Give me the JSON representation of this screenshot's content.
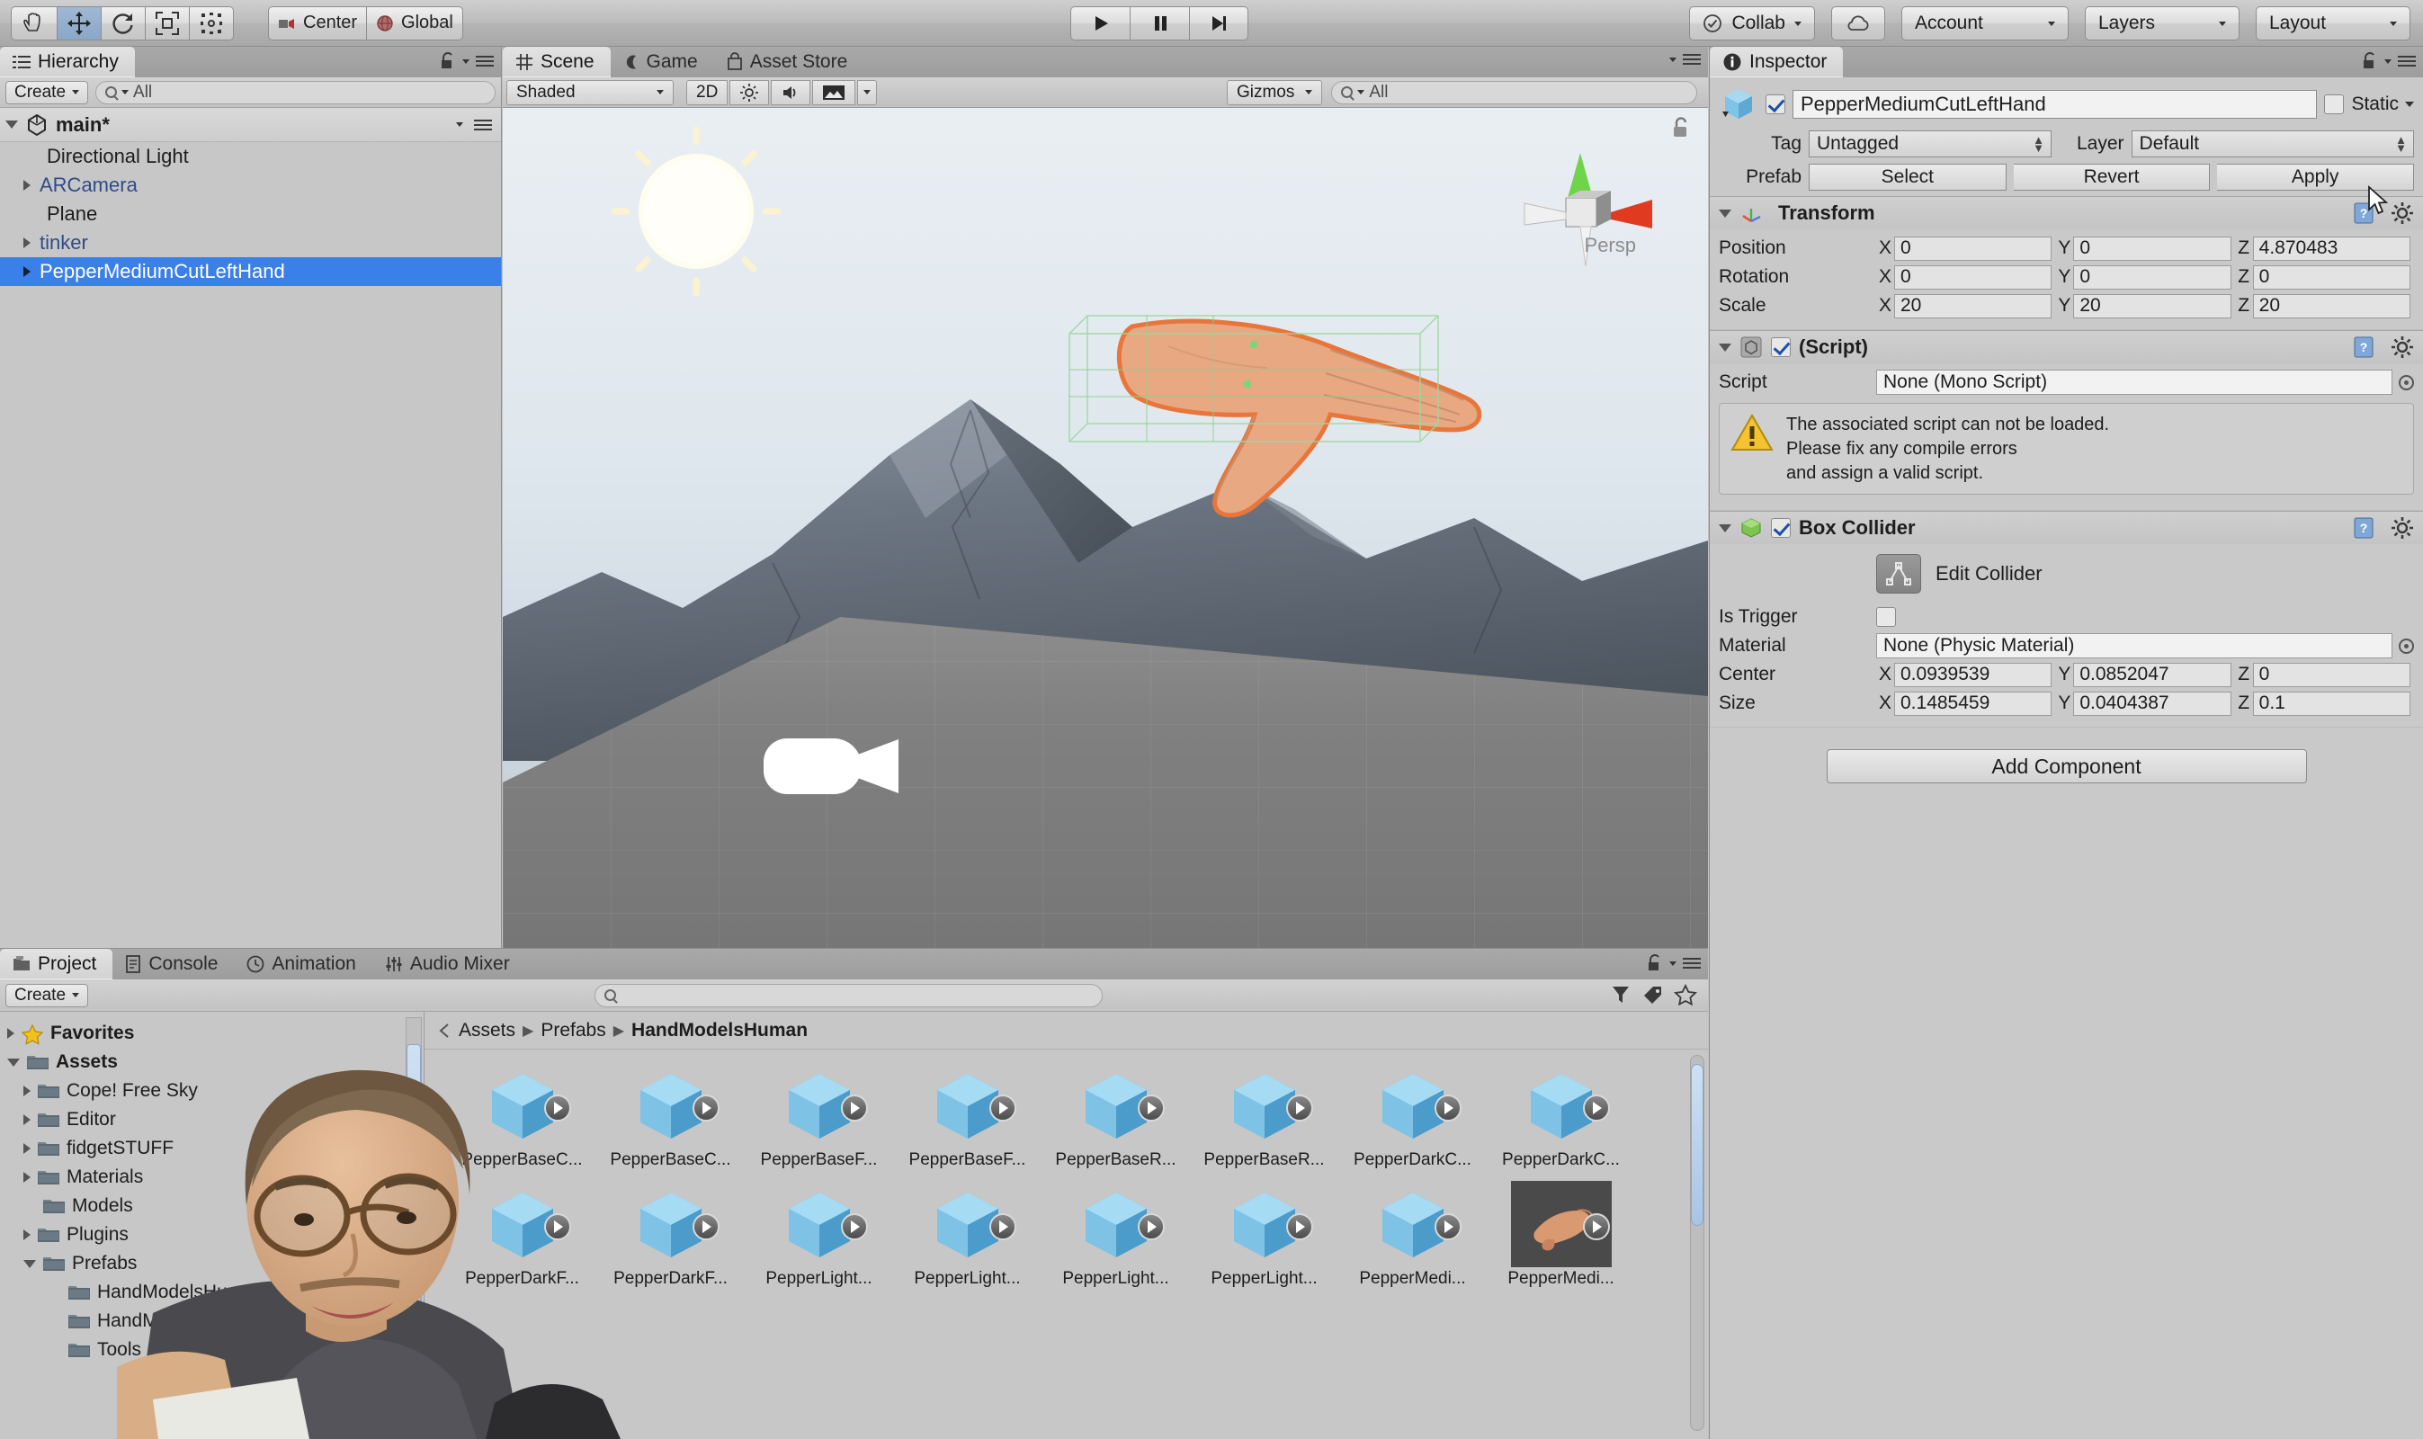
{
  "toolbar": {
    "tools": [
      {
        "name": "hand-tool",
        "icon": "hand"
      },
      {
        "name": "move-tool",
        "icon": "move"
      },
      {
        "name": "rotate-tool",
        "icon": "rotate"
      },
      {
        "name": "scale-tool",
        "icon": "scale"
      },
      {
        "name": "rect-tool",
        "icon": "rect"
      }
    ],
    "pivot_mode": "Center",
    "pivot_rotation": "Global",
    "transport": [
      "play",
      "pause",
      "step"
    ],
    "collab": "Collab",
    "cloud_icon": "cloud-icon",
    "account": "Account",
    "layers": "Layers",
    "layout": "Layout"
  },
  "hierarchy": {
    "tab": "Hierarchy",
    "create_label": "Create",
    "search_placeholder": "All",
    "scene_name": "main*",
    "items": [
      {
        "label": "Directional Light",
        "arrow": false,
        "prefab": false,
        "selected": false
      },
      {
        "label": "ARCamera",
        "arrow": true,
        "prefab": true,
        "selected": false
      },
      {
        "label": "Plane",
        "arrow": false,
        "prefab": false,
        "selected": false
      },
      {
        "label": "tinker",
        "arrow": true,
        "prefab": true,
        "selected": false
      },
      {
        "label": "PepperMediumCutLeftHand",
        "arrow": true,
        "prefab": true,
        "selected": true
      }
    ]
  },
  "scene": {
    "tabs": [
      {
        "label": "Scene",
        "icon": "grid-icon",
        "active": true
      },
      {
        "label": "Game",
        "icon": "gamepad-icon",
        "active": false
      },
      {
        "label": "Asset Store",
        "icon": "store-icon",
        "active": false
      }
    ],
    "draw_mode": "Shaded",
    "two_d": "2D",
    "lighting_icon": "sun-toggle-icon",
    "audio_icon": "audio-toggle-icon",
    "fx_icon": "effects-icon",
    "gizmos": "Gizmos",
    "search_placeholder": "All",
    "projection_label": "Persp"
  },
  "inspector": {
    "tab": "Inspector",
    "object_name": "PepperMediumCutLeftHand",
    "enabled": true,
    "static_label": "Static",
    "static_checked": false,
    "tag_label": "Tag",
    "tag_value": "Untagged",
    "layer_label": "Layer",
    "layer_value": "Default",
    "prefab_label": "Prefab",
    "prefab_buttons": [
      "Select",
      "Revert",
      "Apply"
    ],
    "components": [
      {
        "name": "Transform",
        "icon": "transform-axis-icon",
        "has_checkbox": false,
        "rows": [
          {
            "label": "Position",
            "x": "0",
            "y": "0",
            "z": "4.870483"
          },
          {
            "label": "Rotation",
            "x": "0",
            "y": "0",
            "z": "0"
          },
          {
            "label": "Scale",
            "x": "20",
            "y": "20",
            "z": "20"
          }
        ]
      },
      {
        "name": "(Script)",
        "icon": "script-icon",
        "has_checkbox": true,
        "checked": true,
        "script_label": "Script",
        "script_value": "None (Mono Script)",
        "warning_lines": [
          "The associated script can not be loaded.",
          "Please fix any compile errors",
          "and assign a valid script."
        ]
      },
      {
        "name": "Box Collider",
        "icon": "box-collider-icon",
        "has_checkbox": true,
        "checked": true,
        "edit_collider_label": "Edit Collider",
        "is_trigger_label": "Is Trigger",
        "is_trigger_checked": false,
        "material_label": "Material",
        "material_value": "None (Physic Material)",
        "center": {
          "label": "Center",
          "x": "0.0939539",
          "y": "0.0852047",
          "z": "0"
        },
        "size": {
          "label": "Size",
          "x": "0.1485459",
          "y": "0.0404387",
          "z": "0.1"
        }
      }
    ],
    "add_component": "Add Component"
  },
  "project": {
    "tabs": [
      {
        "label": "Project",
        "icon": "folder-icon",
        "active": true
      },
      {
        "label": "Console",
        "icon": "console-icon",
        "active": false
      },
      {
        "label": "Animation",
        "icon": "clock-icon",
        "active": false
      },
      {
        "label": "Audio Mixer",
        "icon": "mixer-icon",
        "active": false
      }
    ],
    "create_label": "Create",
    "search_placeholder": "",
    "tree": [
      {
        "label": "Favorites",
        "level": 0,
        "arrow": "closed",
        "icon": "star-icon",
        "bold": true
      },
      {
        "label": "Assets",
        "level": 0,
        "arrow": "open",
        "icon": "folder-icon",
        "bold": true
      },
      {
        "label": "Cope! Free Sky",
        "level": 1,
        "arrow": "closed",
        "icon": "folder-icon",
        "bold": false
      },
      {
        "label": "Editor",
        "level": 1,
        "arrow": "closed",
        "icon": "folder-icon",
        "bold": false
      },
      {
        "label": "fidgetSTUFF",
        "level": 1,
        "arrow": "closed",
        "icon": "folder-icon",
        "bold": false
      },
      {
        "label": "Materials",
        "level": 1,
        "arrow": "closed",
        "icon": "folder-icon",
        "bold": false
      },
      {
        "label": "Models",
        "level": 1,
        "arrow": "none",
        "icon": "folder-icon",
        "bold": false
      },
      {
        "label": "Plugins",
        "level": 1,
        "arrow": "closed",
        "icon": "folder-icon",
        "bold": false
      },
      {
        "label": "Prefabs",
        "level": 1,
        "arrow": "open",
        "icon": "folder-icon",
        "bold": false
      },
      {
        "label": "HandModelsHuman",
        "level": 2,
        "arrow": "none",
        "icon": "folder-icon",
        "bold": false
      },
      {
        "label": "HandModelsPhysics",
        "level": 2,
        "arrow": "none",
        "icon": "folder-icon",
        "bold": false
      },
      {
        "label": "Tools",
        "level": 2,
        "arrow": "none",
        "icon": "folder-icon",
        "bold": false
      }
    ],
    "breadcrumb": [
      "Assets",
      "Prefabs",
      "HandModelsHuman"
    ],
    "assets": [
      {
        "label": "PepperBaseC...",
        "thumb": "prefab-cube",
        "selected": false
      },
      {
        "label": "PepperBaseC...",
        "thumb": "prefab-cube",
        "selected": false
      },
      {
        "label": "PepperBaseF...",
        "thumb": "prefab-cube",
        "selected": false
      },
      {
        "label": "PepperBaseF...",
        "thumb": "prefab-cube",
        "selected": false
      },
      {
        "label": "PepperBaseR...",
        "thumb": "prefab-cube",
        "selected": false
      },
      {
        "label": "PepperBaseR...",
        "thumb": "prefab-cube",
        "selected": false
      },
      {
        "label": "PepperDarkC...",
        "thumb": "prefab-cube",
        "selected": false
      },
      {
        "label": "PepperDarkC...",
        "thumb": "prefab-cube",
        "selected": false
      },
      {
        "label": "PepperDarkF...",
        "thumb": "prefab-cube",
        "selected": false
      },
      {
        "label": "PepperDarkF...",
        "thumb": "prefab-cube",
        "selected": false
      },
      {
        "label": "PepperLight...",
        "thumb": "prefab-cube",
        "selected": false
      },
      {
        "label": "PepperLight...",
        "thumb": "prefab-cube",
        "selected": false
      },
      {
        "label": "PepperLight...",
        "thumb": "prefab-cube",
        "selected": false
      },
      {
        "label": "PepperLight...",
        "thumb": "prefab-cube",
        "selected": false
      },
      {
        "label": "PepperMedi...",
        "thumb": "prefab-cube",
        "selected": false
      },
      {
        "label": "PepperMedi...",
        "thumb": "hand-preview",
        "selected": true
      }
    ]
  },
  "colors": {
    "selection_blue": "#3b7fe8",
    "panel_gray": "#c7c7c7",
    "toolbar_gray": "#b4b4b4",
    "prefab_text_blue": "#2f4b86",
    "outline_orange": "#e8763a"
  }
}
